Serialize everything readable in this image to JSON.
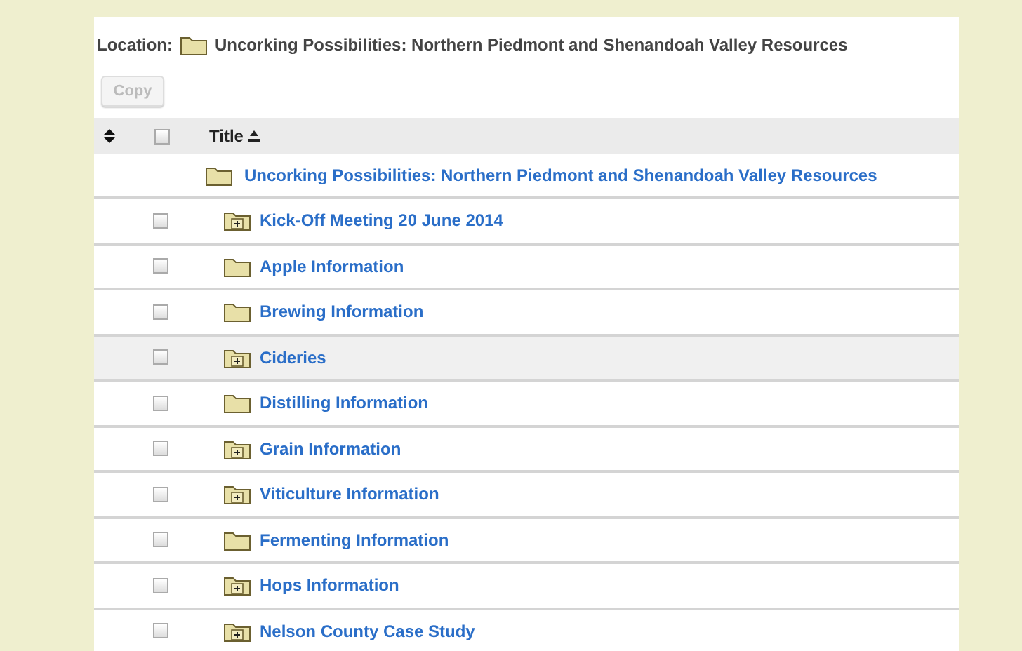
{
  "location": {
    "label": "Location:",
    "title": "Uncorking Possibilities: Northern Piedmont and Shenandoah Valley Resources"
  },
  "copy_button": {
    "label": "Copy",
    "disabled": true
  },
  "table": {
    "header": {
      "select_all_checked": false,
      "title": "Title"
    },
    "parent": {
      "title": "Uncorking Possibilities: Northern Piedmont and Shenandoah Valley Resources"
    },
    "rows": [
      {
        "title": "Kick-Off Meeting 20 June 2014",
        "kind": "folder-plus",
        "checked": false,
        "highlighted": false
      },
      {
        "title": "Apple Information",
        "kind": "folder",
        "checked": false,
        "highlighted": false
      },
      {
        "title": "Brewing Information",
        "kind": "folder",
        "checked": false,
        "highlighted": false
      },
      {
        "title": "Cideries",
        "kind": "folder-plus",
        "checked": false,
        "highlighted": true
      },
      {
        "title": "Distilling Information",
        "kind": "folder",
        "checked": false,
        "highlighted": false
      },
      {
        "title": "Grain Information",
        "kind": "folder-plus",
        "checked": false,
        "highlighted": false
      },
      {
        "title": "Viticulture Information",
        "kind": "folder-plus",
        "checked": false,
        "highlighted": false
      },
      {
        "title": "Fermenting Information",
        "kind": "folder",
        "checked": false,
        "highlighted": false
      },
      {
        "title": "Hops Information",
        "kind": "folder-plus",
        "checked": false,
        "highlighted": false
      },
      {
        "title": "Nelson County Case Study",
        "kind": "folder-plus",
        "checked": false,
        "highlighted": false
      }
    ]
  }
}
